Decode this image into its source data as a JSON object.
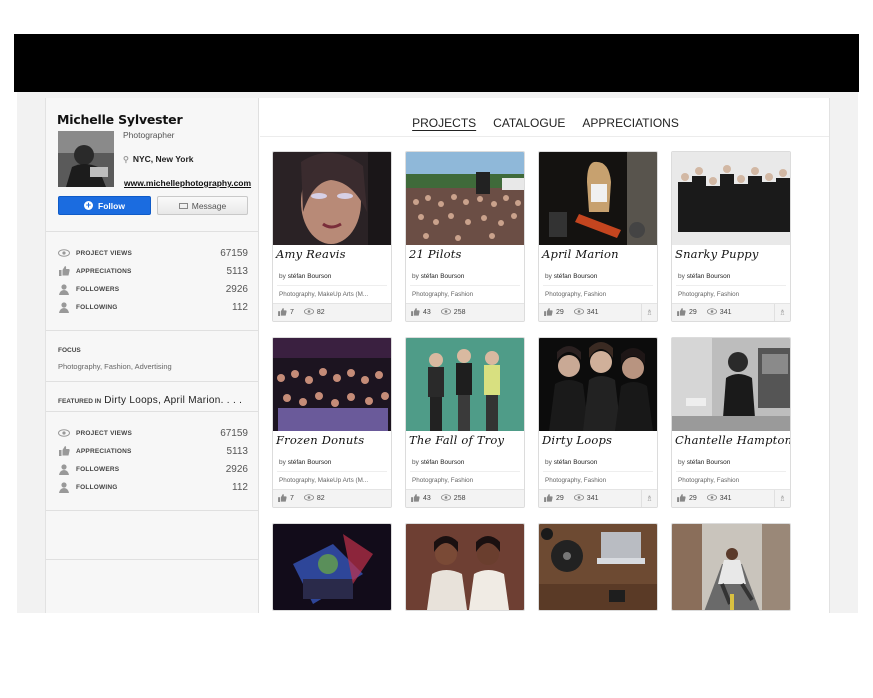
{
  "profile": {
    "name": "Michelle Sylvester",
    "role": "Photographer",
    "location": "NYC, New York",
    "website": "www.michellephotography.com",
    "follow_label": "Follow",
    "message_label": "Message"
  },
  "stats_primary": [
    {
      "label": "PROJECT VIEWS",
      "value": "67159",
      "icon": "eye-icon"
    },
    {
      "label": "APPRECIATIONS",
      "value": "5113",
      "icon": "thumbs-up-icon"
    },
    {
      "label": "FOLLOWERS",
      "value": "2926",
      "icon": "user-icon"
    },
    {
      "label": "FOLLOWING",
      "value": "112",
      "icon": "user-icon"
    }
  ],
  "focus": {
    "title": "FOCUS",
    "value": "Photography, Fashion, Advertising"
  },
  "featured": {
    "prefix": "FEATURED IN",
    "value": "Dirty Loops, April Marion. . . ."
  },
  "stats_secondary": [
    {
      "label": "PROJECT VIEWS",
      "value": "67159",
      "icon": "eye-icon"
    },
    {
      "label": "APPRECIATIONS",
      "value": "5113",
      "icon": "thumbs-up-icon"
    },
    {
      "label": "FOLLOWERS",
      "value": "2926",
      "icon": "user-icon"
    },
    {
      "label": "FOLLOWING",
      "value": "112",
      "icon": "user-icon"
    }
  ],
  "tabs": [
    {
      "label": "PROJECTS",
      "active": true
    },
    {
      "label": "CATALOGUE",
      "active": false
    },
    {
      "label": "APPRECIATIONS",
      "active": false
    }
  ],
  "projects": [
    {
      "title": "Amy Reavis",
      "by_prefix": "by",
      "author": "stéfan Bourson",
      "tags": "Photography, MakeUp Arts (M...",
      "likes": "7",
      "views": "82",
      "badge": false
    },
    {
      "title": "21 Pilots",
      "by_prefix": "by",
      "author": "stéfan Bourson",
      "tags": "Photography, Fashion",
      "likes": "43",
      "views": "258",
      "badge": false
    },
    {
      "title": "April Marion",
      "by_prefix": "by",
      "author": "stéfan Bourson",
      "tags": "Photography, Fashion",
      "likes": "29",
      "views": "341",
      "badge": true
    },
    {
      "title": "Snarky Puppy",
      "by_prefix": "by",
      "author": "stéfan Bourson",
      "tags": "Photography, Fashion",
      "likes": "29",
      "views": "341",
      "badge": true
    },
    {
      "title": "Frozen Donuts",
      "by_prefix": "by",
      "author": "stéfan Bourson",
      "tags": "Photography, MakeUp Arts (M...",
      "likes": "7",
      "views": "82",
      "badge": false
    },
    {
      "title": "The Fall of Troy",
      "by_prefix": "by",
      "author": "stéfan Bourson",
      "tags": "Photography, Fashion",
      "likes": "43",
      "views": "258",
      "badge": false
    },
    {
      "title": "Dirty Loops",
      "by_prefix": "by",
      "author": "stéfan Bourson",
      "tags": "Photography, Fashion",
      "likes": "29",
      "views": "341",
      "badge": true
    },
    {
      "title": "Chantelle Hampton",
      "by_prefix": "by",
      "author": "stéfan Bourson",
      "tags": "Photography, Fashion",
      "likes": "29",
      "views": "341",
      "badge": true
    }
  ],
  "colors": {
    "follow_blue": "#1b6ce0",
    "top_bar": "#000000"
  }
}
